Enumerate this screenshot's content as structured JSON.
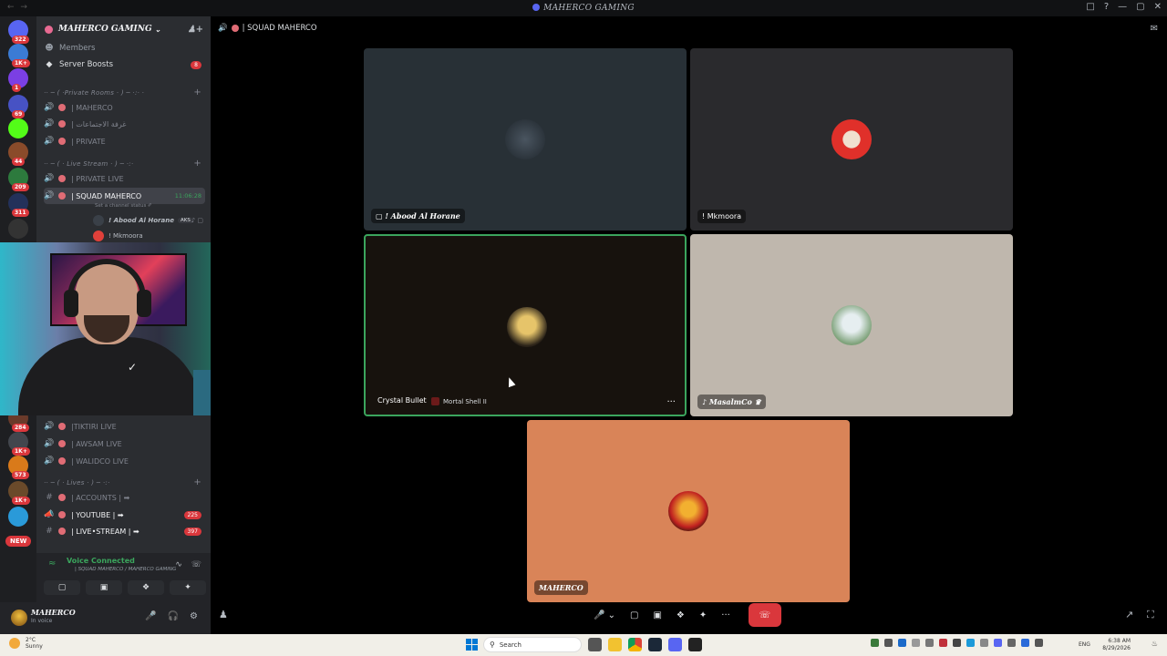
{
  "window": {
    "title": "MAHERCO GAMING"
  },
  "rail": {
    "servers": [
      {
        "name": "home",
        "badge": "322",
        "color": "#5865f2"
      },
      {
        "name": "server-1",
        "badge": "1K+",
        "color": "#3b7bd4"
      },
      {
        "name": "server-2",
        "badge": "1",
        "color": "#7b3fe4"
      },
      {
        "name": "server-3",
        "badge": "69",
        "color": "#4752c4"
      },
      {
        "name": "server-kick",
        "badge": "",
        "color": "#53fc18"
      },
      {
        "name": "server-5",
        "badge": "44",
        "color": "#8a4b2a"
      },
      {
        "name": "server-6",
        "badge": "209",
        "color": "#2d7a3d"
      },
      {
        "name": "server-7",
        "badge": "311",
        "color": "#23315a"
      },
      {
        "name": "server-8",
        "badge": "",
        "color": "#333"
      },
      {
        "name": "server-9",
        "badge": "284",
        "color": "#6a3a2a"
      },
      {
        "name": "server-10",
        "badge": "1K+",
        "color": "#42464d"
      },
      {
        "name": "server-11",
        "badge": "573",
        "color": "#d97a1a"
      },
      {
        "name": "server-12",
        "badge": "1K+",
        "color": "#6a4a2a"
      },
      {
        "name": "server-13",
        "badge": "",
        "color": "#2a9ad9"
      }
    ],
    "new_label": "NEW"
  },
  "guild": {
    "name": "MAHERCO GAMING"
  },
  "nav": {
    "members": "Members",
    "boosts": "Server Boosts",
    "boosts_badge": "8"
  },
  "categories": {
    "private": "·· ─ ( ·Private Rooms · ) ─ ·:· ·",
    "live": "·· ─ ( · Live Stream · ) ─ ·:·",
    "lives": "·· ─ ( · Lives · ) ─ ·:·"
  },
  "channels": {
    "maherco": "| MAHERCO",
    "meetings": "| غرفة الاجتماعات",
    "private": "| PRIVATE",
    "private_live": "| PRIVATE LIVE",
    "squad": "| SQUAD MAHERCO",
    "squad_time": "11:06:28",
    "squad_status": "Set a channel status ✐",
    "tiktiri": "|TIKTIRI LIVE",
    "awsam": "| AWSAM LIVE",
    "walidco": "| WALIDCO LIVE",
    "accounts": "| ACCOUNTS | ➡",
    "youtube": "| YOUTUBE | ➡",
    "youtube_count": "225",
    "livestream": "| LIVE•STREAM | ➡",
    "livestream_count": "397"
  },
  "voice_users": [
    {
      "name": "! Abood Al Horane",
      "tag": "AKS"
    },
    {
      "name": "! Mkmoora",
      "tag": ""
    }
  ],
  "voice_panel": {
    "status": "Voice Connected",
    "channel": "| SQUAD MAHERCO / MAHERCO GAMING"
  },
  "user_panel": {
    "name": "MAHERCO",
    "status": "In voice"
  },
  "main": {
    "channel": "| SQUAD MAHERCO"
  },
  "tiles": [
    {
      "name": "! Abood Al Horane",
      "bg": "#283036"
    },
    {
      "name": "! Mkmoora",
      "bg": "#2a2a2d"
    },
    {
      "name": "Crystal Bullet",
      "game": "Mortal Shell II",
      "bg": "#17120d"
    },
    {
      "name": "MasalmCo ♛",
      "bg": "#bfb7ad"
    },
    {
      "name": "MAHERCO",
      "bg": "#d98458"
    }
  ],
  "taskbar": {
    "weather_temp": "2°C",
    "weather_desc": "Sunny",
    "search": "Search",
    "lang": "ENG",
    "time": "6:38 AM",
    "date": "8/29/2026"
  }
}
